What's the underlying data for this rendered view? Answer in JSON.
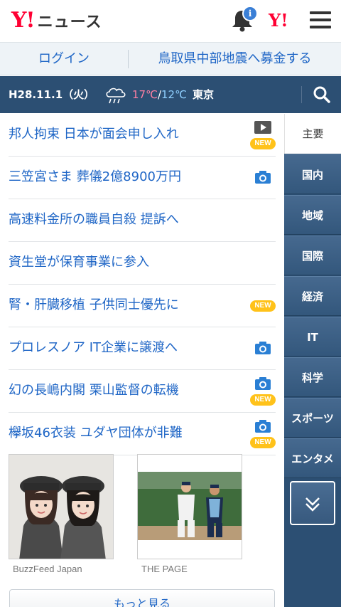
{
  "header": {
    "logo_mark": "Y!",
    "logo_text": "ニュース",
    "notification_badge": "i",
    "yahoo_mini": "Y!"
  },
  "loginbar": {
    "login": "ログイン",
    "donate": "鳥取県中部地震へ募金する"
  },
  "infobar": {
    "date": "H28.11.1（火）",
    "weather_icon": "cloud-rain-icon",
    "temp_high": "17℃",
    "temp_sep": "/",
    "temp_low": "12℃",
    "city": "東京"
  },
  "news": [
    {
      "title": "邦人拘束 日本が面会申し入れ",
      "icons": [
        "video",
        "new"
      ]
    },
    {
      "title": "三笠宮さま 葬儀2億8900万円",
      "icons": [
        "camera"
      ]
    },
    {
      "title": "高速料金所の職員自殺 提訴へ",
      "icons": []
    },
    {
      "title": "資生堂が保育事業に参入",
      "icons": []
    },
    {
      "title": "腎・肝臓移植 子供同士優先に",
      "icons": [
        "new"
      ]
    },
    {
      "title": "プロレスノア IT企業に譲渡へ",
      "icons": [
        "camera"
      ]
    },
    {
      "title": "幻の長嶋内閣 栗山監督の転機",
      "icons": [
        "camera",
        "new"
      ]
    },
    {
      "title": "欅坂46衣装 ユダヤ団体が非難",
      "icons": [
        "camera",
        "new"
      ]
    }
  ],
  "new_badge": "NEW",
  "photos": [
    {
      "source": "BuzzFeed Japan"
    },
    {
      "source": "THE PAGE"
    }
  ],
  "more_label": "もっと見る",
  "sidenav": {
    "items": [
      "主要",
      "国内",
      "地域",
      "国際",
      "経済",
      "IT",
      "科学",
      "スポーツ",
      "エンタメ"
    ],
    "active": "主要"
  },
  "colors": {
    "brand_red": "#ff0033",
    "link_blue": "#1f66c6",
    "nav_navy": "#2c4f73",
    "new_yellow": "#ffc21a"
  }
}
